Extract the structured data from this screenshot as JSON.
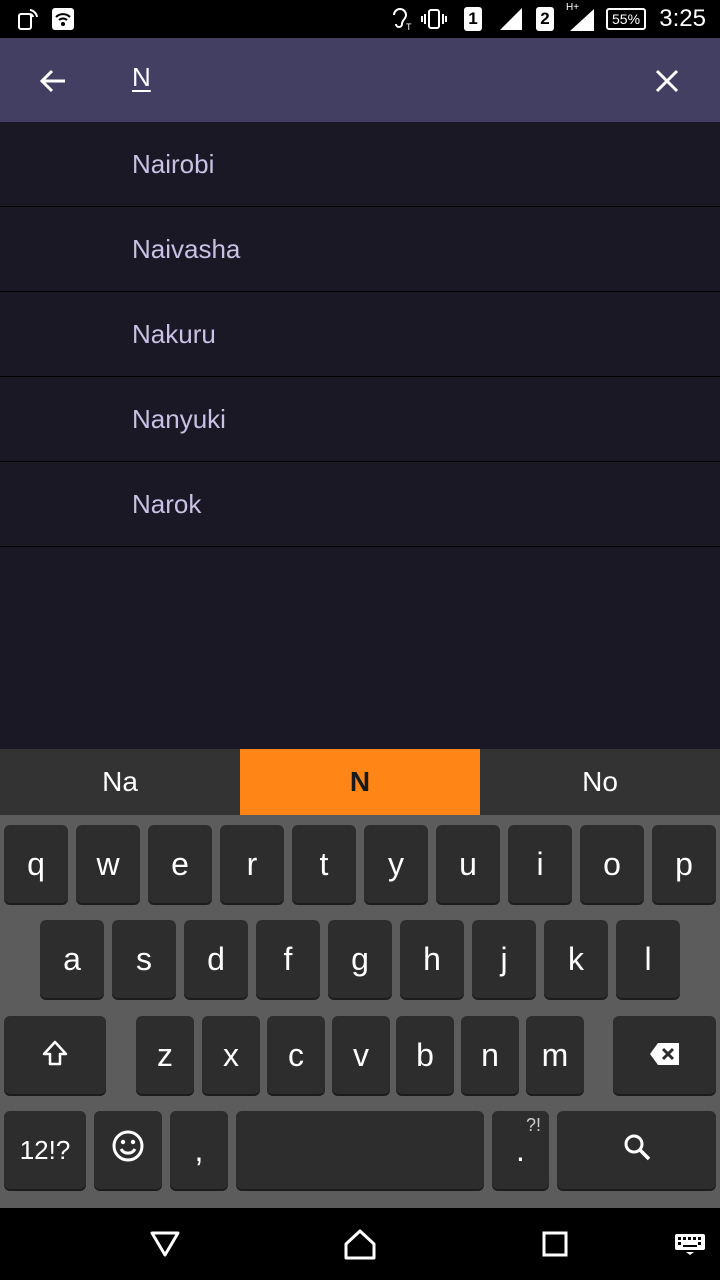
{
  "status_bar": {
    "sim1": "1",
    "sim2": "2",
    "network_type": "H+",
    "battery": "55%",
    "time": "3:25"
  },
  "search": {
    "query": "N",
    "back_icon": "arrow-left-icon",
    "clear_icon": "close-icon"
  },
  "results": [
    "Nairobi",
    "Naivasha",
    "Nakuru",
    "Nanyuki",
    "Narok"
  ],
  "suggestions": [
    {
      "label": "Na",
      "active": false
    },
    {
      "label": "N",
      "active": true
    },
    {
      "label": "No",
      "active": false
    }
  ],
  "keyboard": {
    "row1": [
      "q",
      "w",
      "e",
      "r",
      "t",
      "y",
      "u",
      "i",
      "o",
      "p"
    ],
    "row2": [
      "a",
      "s",
      "d",
      "f",
      "g",
      "h",
      "j",
      "k",
      "l"
    ],
    "row3": [
      "z",
      "x",
      "c",
      "v",
      "b",
      "n",
      "m"
    ],
    "symbols_label": "12!?",
    "comma_label": ",",
    "period_label": ".",
    "period_hint": "?!",
    "shift_icon": "shift-icon",
    "backspace_icon": "backspace-icon",
    "emoji_icon": "emoji-icon",
    "search_icon": "search-icon"
  },
  "colors": {
    "appbar": "#433f62",
    "background": "#1a1824",
    "result_text": "#c9c0e6",
    "suggestion_active": "#ff8517"
  }
}
